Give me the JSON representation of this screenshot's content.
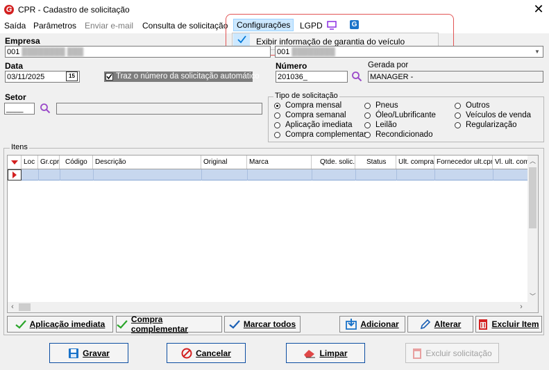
{
  "window": {
    "title": "CPR - Cadastro de solicitação"
  },
  "menu": {
    "items": [
      "Saída",
      "Parâmetros",
      "Enviar e-mail",
      "Consulta de solicitação",
      "Configurações",
      "LGPD"
    ],
    "popup_item": "Exibir informação de garantia do veículo"
  },
  "form": {
    "empresa_label": "Empresa",
    "empresa_value": "001",
    "empresa_value2": "001",
    "data_label": "Data",
    "data_value": "03/11/2025",
    "calendar_icon_text": "15",
    "auto_label": "Traz o número da solicitação automático",
    "numero_label": "Número",
    "numero_value": "201036_",
    "gerada_label": "Gerada por",
    "gerada_value": "MANAGER -",
    "setor_label": "Setor",
    "setor_value": "____"
  },
  "tipo": {
    "legend": "Tipo de solicitação",
    "options": [
      "Compra mensal",
      "Compra semanal",
      "Aplicação imediata",
      "Compra complementar",
      "Pneus",
      "Óleo/Lubrificante",
      "Leilão",
      "Recondicionado",
      "Outros",
      "Veículos de venda",
      "Regularização"
    ],
    "selected": "Compra mensal"
  },
  "itens": {
    "legend": "Itens",
    "columns": [
      "Loc",
      "Gr.cpr",
      "Código",
      "Descrição",
      "Original",
      "Marca",
      "Qtde. solic.",
      "Status",
      "Ult. compra",
      "Fornecedor ult.cpr",
      "Vl. ult. com"
    ]
  },
  "buttons": {
    "aplicacao": "Aplicação imediata",
    "complementar": "Compra complementar",
    "marcar": "Marcar todos",
    "adicionar": "Adicionar",
    "alterar": "Alterar",
    "excluir_item": "Excluir Item",
    "gravar": "Gravar",
    "cancelar": "Cancelar",
    "limpar": "Limpar",
    "excluir_sol": "Excluir solicitação"
  },
  "colors": {
    "accent": "#0078d7",
    "row_select": "#c7d7ee",
    "red": "#d32020"
  }
}
